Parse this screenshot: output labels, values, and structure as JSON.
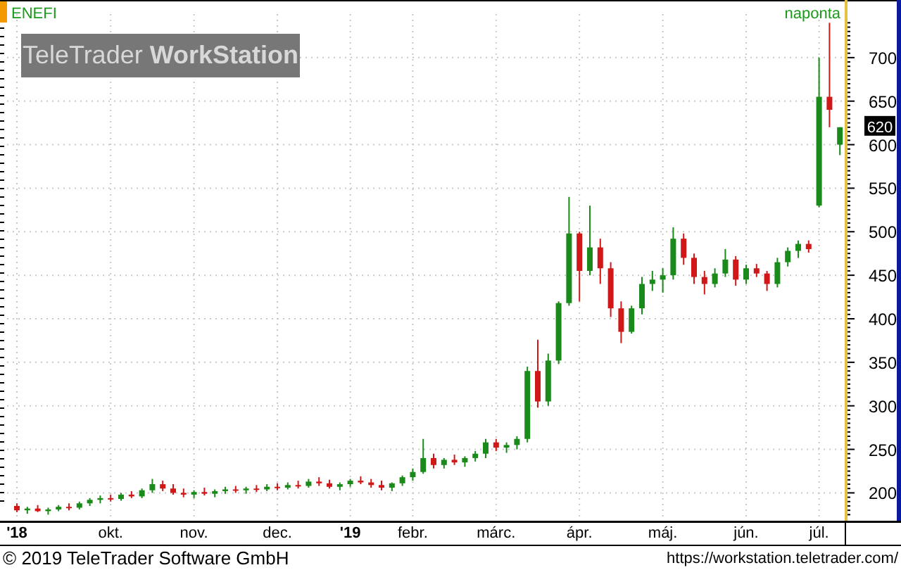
{
  "chart": {
    "symbol": "ENEFI",
    "interval": "naponta",
    "logo": "TeleTrader **WorkStation**",
    "last_price": "620",
    "chart_data": {
      "type": "candlestick",
      "grid": true,
      "ylim": [
        168,
        750
      ],
      "yticks": [
        200,
        250,
        300,
        350,
        400,
        450,
        500,
        550,
        600,
        650,
        700
      ],
      "categories": [
        "**'18**",
        null,
        null,
        null,
        null,
        null,
        null,
        null,
        null,
        "okt.",
        null,
        null,
        null,
        null,
        null,
        null,
        null,
        "nov.",
        null,
        null,
        null,
        null,
        null,
        null,
        null,
        "dec.",
        null,
        null,
        null,
        null,
        null,
        null,
        "**'19**",
        null,
        null,
        null,
        null,
        null,
        "febr.",
        null,
        null,
        null,
        null,
        null,
        null,
        null,
        "márc.",
        null,
        null,
        null,
        null,
        null,
        null,
        null,
        "ápr.",
        null,
        null,
        null,
        null,
        null,
        null,
        null,
        "máj.",
        null,
        null,
        null,
        null,
        null,
        null,
        null,
        "jún.",
        null,
        null,
        null,
        null,
        null,
        null,
        "júl.",
        null,
        null
      ],
      "ohlc": [
        [
          185,
          188,
          178,
          180
        ],
        [
          180,
          184,
          176,
          182
        ],
        [
          182,
          186,
          178,
          179
        ],
        [
          179,
          183,
          175,
          181
        ],
        [
          181,
          186,
          179,
          184
        ],
        [
          184,
          188,
          180,
          183
        ],
        [
          183,
          190,
          181,
          188
        ],
        [
          188,
          194,
          185,
          192
        ],
        [
          192,
          197,
          188,
          194
        ],
        [
          194,
          198,
          190,
          193
        ],
        [
          193,
          200,
          191,
          198
        ],
        [
          198,
          202,
          194,
          196
        ],
        [
          196,
          205,
          194,
          203
        ],
        [
          203,
          216,
          200,
          210
        ],
        [
          210,
          214,
          202,
          205
        ],
        [
          205,
          210,
          198,
          200
        ],
        [
          200,
          205,
          195,
          198
        ],
        [
          198,
          203,
          194,
          201
        ],
        [
          201,
          206,
          197,
          199
        ],
        [
          199,
          204,
          195,
          202
        ],
        [
          202,
          207,
          199,
          204
        ],
        [
          204,
          208,
          200,
          203
        ],
        [
          203,
          207,
          199,
          205
        ],
        [
          205,
          209,
          201,
          204
        ],
        [
          204,
          210,
          202,
          207
        ],
        [
          207,
          211,
          203,
          206
        ],
        [
          206,
          212,
          204,
          209
        ],
        [
          209,
          214,
          205,
          208
        ],
        [
          208,
          216,
          206,
          213
        ],
        [
          213,
          218,
          208,
          211
        ],
        [
          211,
          215,
          205,
          207
        ],
        [
          207,
          212,
          203,
          210
        ],
        [
          210,
          216,
          207,
          214
        ],
        [
          214,
          219,
          210,
          212
        ],
        [
          212,
          216,
          206,
          209
        ],
        [
          209,
          214,
          203,
          206
        ],
        [
          206,
          212,
          202,
          211
        ],
        [
          211,
          220,
          208,
          218
        ],
        [
          218,
          228,
          214,
          224
        ],
        [
          224,
          262,
          222,
          240
        ],
        [
          240,
          245,
          228,
          232
        ],
        [
          232,
          240,
          228,
          238
        ],
        [
          238,
          244,
          232,
          235
        ],
        [
          235,
          242,
          230,
          240
        ],
        [
          240,
          248,
          236,
          245
        ],
        [
          245,
          262,
          240,
          258
        ],
        [
          258,
          262,
          248,
          252
        ],
        [
          252,
          258,
          246,
          255
        ],
        [
          255,
          265,
          250,
          262
        ],
        [
          262,
          345,
          258,
          340
        ],
        [
          340,
          376,
          298,
          305
        ],
        [
          305,
          360,
          300,
          352
        ],
        [
          352,
          420,
          348,
          418
        ],
        [
          418,
          540,
          415,
          498
        ],
        [
          498,
          500,
          420,
          455
        ],
        [
          455,
          530,
          450,
          482
        ],
        [
          482,
          492,
          440,
          458
        ],
        [
          458,
          465,
          402,
          412
        ],
        [
          412,
          420,
          372,
          385
        ],
        [
          385,
          415,
          383,
          412
        ],
        [
          412,
          448,
          405,
          440
        ],
        [
          440,
          455,
          432,
          445
        ],
        [
          445,
          458,
          430,
          450
        ],
        [
          450,
          505,
          445,
          492
        ],
        [
          492,
          498,
          462,
          470
        ],
        [
          470,
          475,
          440,
          448
        ],
        [
          448,
          455,
          428,
          440
        ],
        [
          440,
          458,
          436,
          452
        ],
        [
          452,
          480,
          448,
          468
        ],
        [
          468,
          472,
          438,
          445
        ],
        [
          445,
          462,
          440,
          458
        ],
        [
          458,
          463,
          448,
          452
        ],
        [
          452,
          455,
          432,
          440
        ],
        [
          440,
          470,
          436,
          465
        ],
        [
          465,
          482,
          460,
          478
        ],
        [
          478,
          490,
          470,
          486
        ],
        [
          486,
          490,
          476,
          480
        ],
        [
          530,
          700,
          528,
          655
        ],
        [
          655,
          740,
          620,
          640
        ],
        [
          600,
          620,
          588,
          620
        ]
      ]
    }
  },
  "footer": {
    "copyright": "© 2019 TeleTrader Software GmbH",
    "url": "https://workstation.teletrader.com/"
  }
}
